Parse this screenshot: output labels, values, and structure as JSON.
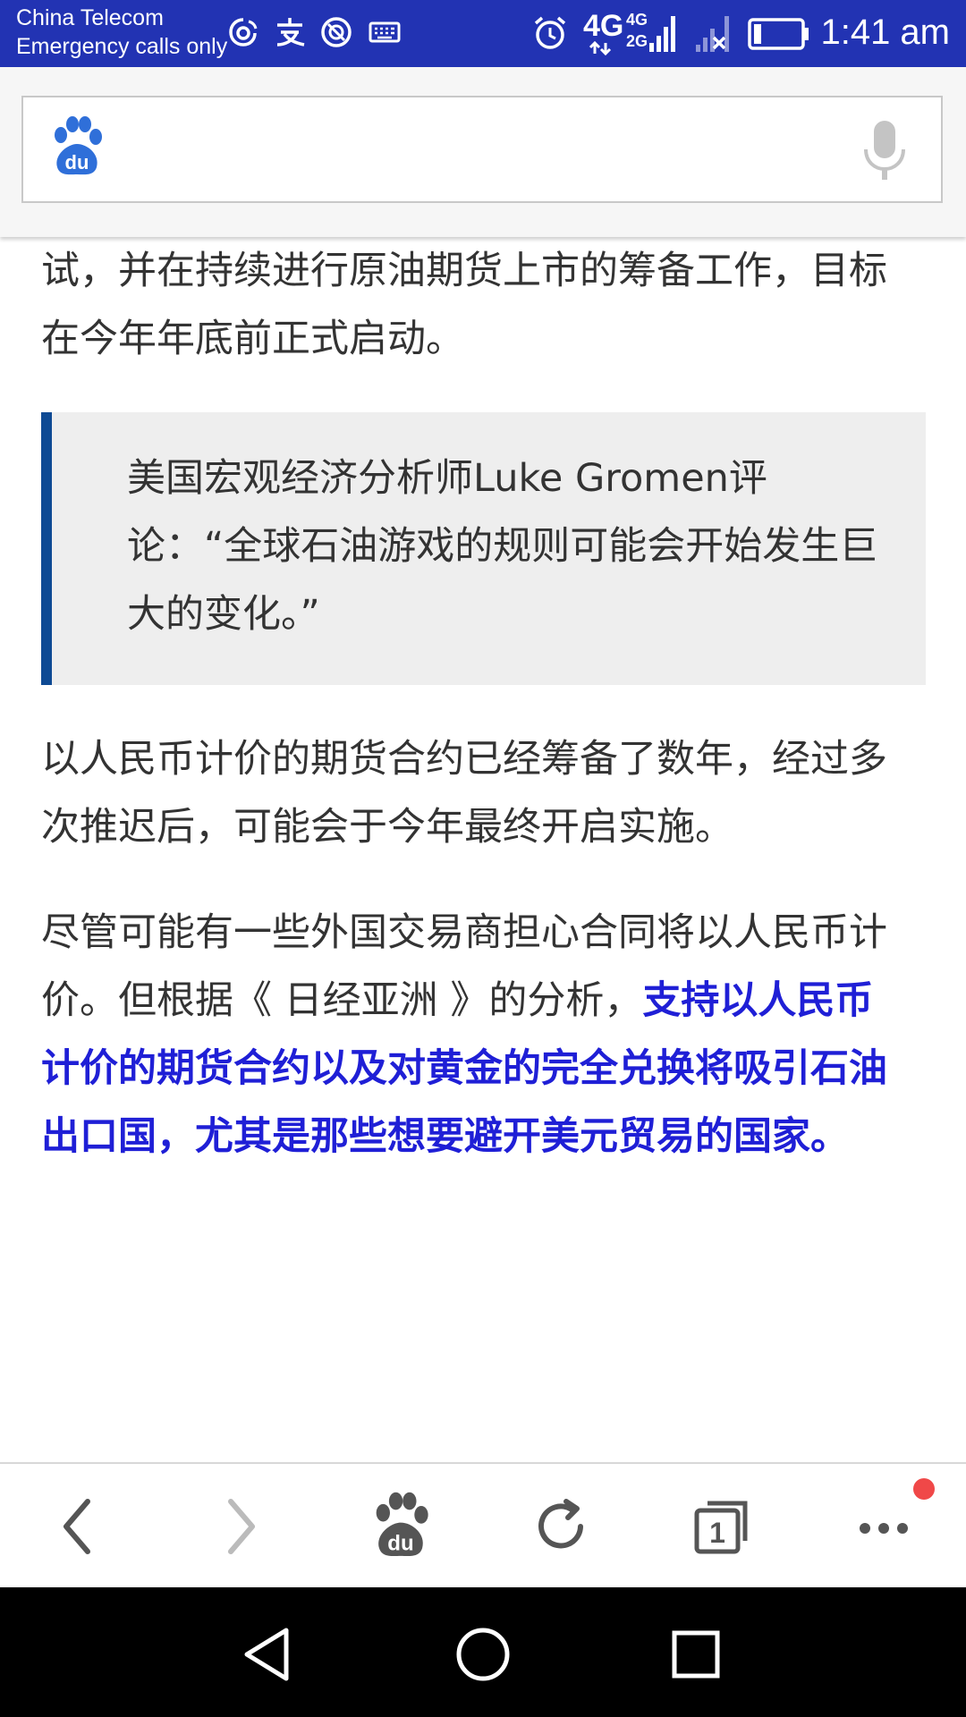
{
  "status_bar": {
    "carrier": "China Telecom",
    "service": "Emergency calls only",
    "network_primary": "4G",
    "network_secondary_top": "4G",
    "network_secondary_bottom": "2G",
    "time": "1:41 am",
    "icons": [
      "weibo-icon",
      "alipay-icon",
      "sync-icon",
      "keyboard-icon",
      "alarm-icon",
      "signal-icon",
      "no-signal-icon",
      "battery-icon"
    ],
    "background_color": "#2233b3"
  },
  "search": {
    "placeholder": "",
    "logo": "baidu-paw-icon",
    "mic": "microphone-icon"
  },
  "article": {
    "paragraph_1": "试，并在持续进行原油期货上市的筹备工作，目标在今年年底前正式启动。",
    "quote": "美国宏观经济分析师Luke Gromen评论：“全球石油游戏的规则可能会开始发生巨大的变化。”",
    "paragraph_2": "以人民币计价的期货合约已经筹备了数年，经过多次推迟后，可能会于今年最终开启实施。",
    "paragraph_3_plain": "尽管可能有一些外国交易商担心合同将以人民币计价。但根据《 日经亚洲 》的分析，",
    "paragraph_3_highlight": "支持以人民币计价的期货合约以及对黄金的完全兑换将吸引石油出口国，尤其是那些想要避开美元贸易的国家。",
    "highlight_color": "#1f1fd6",
    "quote_bar_color": "#0e4a94"
  },
  "toolbar": {
    "buttons": [
      "back-icon",
      "forward-icon",
      "baidu-home-icon",
      "refresh-icon",
      "tabs-icon",
      "more-icon"
    ],
    "tab_count": "1",
    "notification_color": "#f04848"
  },
  "nav_bar": {
    "buttons": [
      "nav-back-icon",
      "nav-home-icon",
      "nav-recents-icon"
    ]
  }
}
